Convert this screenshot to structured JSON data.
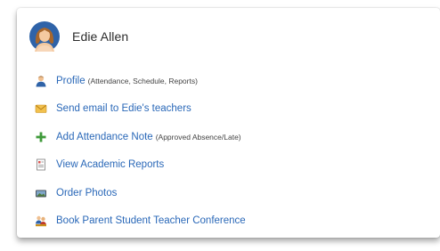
{
  "student": {
    "name": "Edie Allen"
  },
  "links": [
    {
      "label": "Profile",
      "note": "(Attendance, Schedule, Reports)",
      "icon": "user-icon"
    },
    {
      "label": "Send email to Edie's teachers",
      "note": "",
      "icon": "envelope-icon"
    },
    {
      "label": "Add Attendance Note",
      "note": "(Approved Absence/Late)",
      "icon": "plus-icon"
    },
    {
      "label": "View Academic Reports",
      "note": "",
      "icon": "report-icon"
    },
    {
      "label": "Order Photos",
      "note": "",
      "icon": "camera-icon"
    },
    {
      "label": "Book Parent Student Teacher Conference",
      "note": "",
      "icon": "conference-icon"
    }
  ],
  "colors": {
    "link": "#2a68b8",
    "add_icon": "#3f9a3a",
    "email_icon": "#e7b63d"
  }
}
